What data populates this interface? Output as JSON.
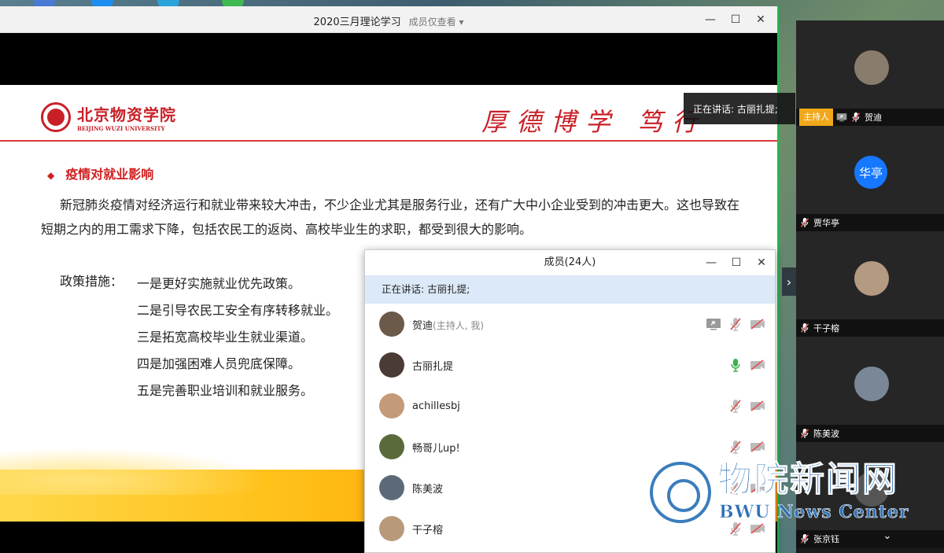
{
  "meeting": {
    "title": "2020三月理论学习",
    "view_mode": "成员仅查看 ▾"
  },
  "window_buttons": {
    "minimize": "—",
    "maximize": "☐",
    "close": "✕"
  },
  "slide": {
    "logo_cn": "北京物资学院",
    "logo_en": "BEIJING WUZI UNIVERSITY",
    "motto": "厚德博学 笃行",
    "section_title": "疫情对就业影响",
    "section_marker": "◆",
    "paragraph": "新冠肺炎疫情对经济运行和就业带来较大冲击，不少企业尤其是服务行业，还有广大中小企业受到的冲击更大。这也导致在短期之内的用工需求下降，包括农民工的返岗、高校毕业生的求职，都受到很大的影响。",
    "policy_label": "政策措施：",
    "policies": [
      "一是更好实施就业优先政策。",
      "二是引导农民工安全有序转移就业。",
      "三是拓宽高校毕业生就业渠道。",
      "四是加强困难人员兜底保障。",
      "五是完善职业培训和就业服务。"
    ]
  },
  "speaking_tip": "正在讲话: 古丽扎提;",
  "members_panel": {
    "title": "成员(24人)",
    "speaking": "正在讲话: 古丽扎提;",
    "members": [
      {
        "name": "贺迪",
        "note": "(主持人, 我)",
        "avatar": "#6b5a4a",
        "share": true,
        "mic_on": false
      },
      {
        "name": "古丽扎提",
        "note": "",
        "avatar": "#4a3b34",
        "share": false,
        "mic_on": true
      },
      {
        "name": "achillesbj",
        "note": "",
        "avatar": "#c49a78",
        "share": false,
        "mic_on": false
      },
      {
        "name": "畅哥儿up!",
        "note": "",
        "avatar": "#5b6a3a",
        "share": false,
        "mic_on": false
      },
      {
        "name": "陈美波",
        "note": "",
        "avatar": "#5c6a78",
        "share": false,
        "mic_on": false
      },
      {
        "name": "干子榕",
        "note": "",
        "avatar": "#b89a7a",
        "share": false,
        "mic_on": false
      }
    ]
  },
  "video_tiles": [
    {
      "name": "贺迪",
      "host_badge": "主持人",
      "avatar": "#8a7c6c",
      "initials": ""
    },
    {
      "name": "贾华亭",
      "host_badge": "",
      "avatar": "#1677ff",
      "initials": "华亭"
    },
    {
      "name": "干子榕",
      "host_badge": "",
      "avatar": "#b49a80",
      "initials": ""
    },
    {
      "name": "陈美波",
      "host_badge": "",
      "avatar": "#7a8896",
      "initials": ""
    },
    {
      "name": "张京钰",
      "host_badge": "",
      "avatar": "#555",
      "initials": ""
    }
  ],
  "panel_arrow": "›",
  "expand_icon": "⌄",
  "watermark": {
    "cn": "物院新闻网",
    "en": "BWU News Center"
  },
  "colors": {
    "accent_red": "#c92027",
    "host_orange": "#f0a81a",
    "mic_green": "#3cb34a",
    "muted_red": "#e05a5a",
    "watermark_blue": "#2e6fb5"
  }
}
